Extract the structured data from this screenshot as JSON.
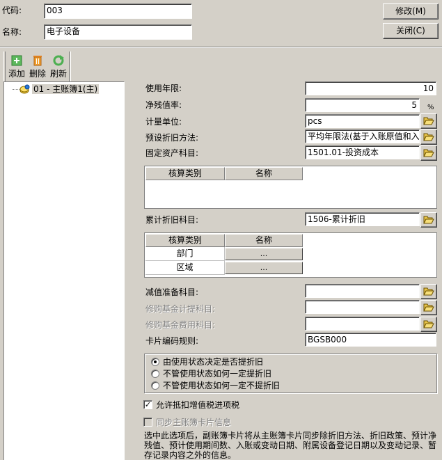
{
  "header": {
    "code_label": "代码:",
    "code_value": "003",
    "name_label": "名称:",
    "name_value": "电子设备",
    "modify_button": "修改(M)",
    "close_button": "关闭(C)"
  },
  "toolbar": {
    "add_label": "添加",
    "delete_label": "删除",
    "refresh_label": "刷新"
  },
  "tree": {
    "root_label": "01 - 主账簿1(主)"
  },
  "form": {
    "useful_life_label": "使用年限:",
    "useful_life_value": "10",
    "residual_rate_label": "净残值率:",
    "residual_rate_value": "5",
    "residual_rate_unit": "%",
    "unit_label": "计量单位:",
    "unit_value": "pcs",
    "depreciation_method_label": "预设折旧方法:",
    "depreciation_method_value": "平均年限法(基于入账原值和入",
    "fixed_asset_account_label": "固定资产科目:",
    "fixed_asset_account_value": "1501.01-投资成本",
    "grid1": {
      "col1": "核算类别",
      "col2": "名称"
    },
    "accum_depr_label": "累计折旧科目:",
    "accum_depr_value": "1506-累计折旧",
    "grid2": {
      "col1": "核算类别",
      "col2": "名称",
      "rows": [
        {
          "category": "部门",
          "name": "..."
        },
        {
          "category": "区域",
          "name": "..."
        }
      ]
    },
    "impairment_label": "减值准备科目:",
    "impairment_value": "",
    "repair_fund_accrual_label": "修购基金计提科目:",
    "repair_fund_accrual_value": "",
    "repair_fund_expense_label": "修购基金费用科目:",
    "repair_fund_expense_value": "",
    "card_code_rule_label": "卡片编码规则:",
    "card_code_rule_value": "BGSB000",
    "radio_options": [
      "由使用状态决定是否提折旧",
      "不管使用状态如何一定提折旧",
      "不管使用状态如何一定不提折旧"
    ],
    "vat_deduct_label": "允许抵扣增值税进项税",
    "vat_deduct_mark": "✓",
    "sync_label": "同步主账簿卡片信息",
    "note": "选中此选项后，副账簿卡片将从主账簿卡片同步除折旧方法、折旧政策、预计净残值、预计使用期间数、入账或变动日期、附属设备登记日期以及变动记录、暂存记录内容之外的信息。"
  },
  "colors": {
    "face": "#d4d0c8",
    "shadow": "#808080",
    "highlight": "#ffffff",
    "selection": "#d4d0c8"
  }
}
